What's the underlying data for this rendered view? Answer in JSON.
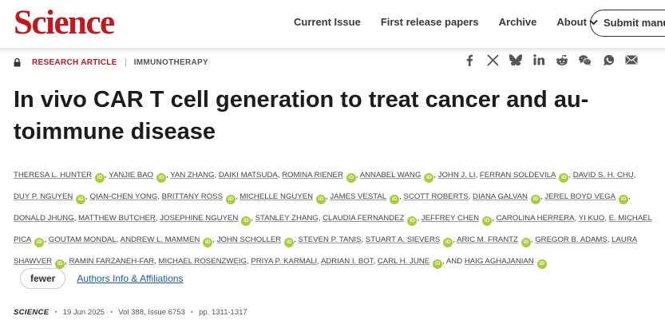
{
  "header": {
    "logo": "Science",
    "nav": [
      "Current Issue",
      "First release papers",
      "Archive",
      "About"
    ],
    "submit_label": "Submit manuscript"
  },
  "meta": {
    "article_type": "RESEARCH ARTICLE",
    "subject": "IMMUNOTHERAPY"
  },
  "share_icons": [
    "facebook-icon",
    "x-icon",
    "bluesky-icon",
    "linkedin-icon",
    "reddit-icon",
    "wechat-icon",
    "whatsapp-icon",
    "email-icon"
  ],
  "title": "In vivo CAR T cell generation to treat cancer and au-toimmune disease",
  "authors": [
    {
      "name": "Theresa L. Hunter",
      "orcid": true
    },
    {
      "name": "Yanjie Bao",
      "orcid": true
    },
    {
      "name": "Yan Zhang",
      "orcid": false
    },
    {
      "name": "Daiki Matsuda",
      "orcid": false
    },
    {
      "name": "Romina Riener",
      "orcid": true
    },
    {
      "name": "Annabel Wang",
      "orcid": true
    },
    {
      "name": "John J. Li",
      "orcid": false
    },
    {
      "name": "Ferran Soldevila",
      "orcid": true
    },
    {
      "name": "David S. H. Chu",
      "orcid": false
    },
    {
      "name": "Duy P. Nguyen",
      "orcid": true
    },
    {
      "name": "Qian-Chen Yong",
      "orcid": false
    },
    {
      "name": "Brittany Ross",
      "orcid": true
    },
    {
      "name": "Michelle Nguyen",
      "orcid": true
    },
    {
      "name": "James Vestal",
      "orcid": true
    },
    {
      "name": "Scott Roberts",
      "orcid": false
    },
    {
      "name": "Diana Galvan",
      "orcid": true
    },
    {
      "name": "Jerel Boyd Vega",
      "orcid": true
    },
    {
      "name": "Donald Jhung",
      "orcid": false
    },
    {
      "name": "Matthew Butcher",
      "orcid": false
    },
    {
      "name": "Josephine Nguyen",
      "orcid": true
    },
    {
      "name": "Stanley Zhang",
      "orcid": false
    },
    {
      "name": "Claudia Fernandez",
      "orcid": true
    },
    {
      "name": "Jeffrey Chen",
      "orcid": true
    },
    {
      "name": "Carolina Herrera",
      "orcid": false
    },
    {
      "name": "Yi Kuo",
      "orcid": false
    },
    {
      "name": "E. Michael Pica",
      "orcid": true
    },
    {
      "name": "Goutam Mondal",
      "orcid": false
    },
    {
      "name": "Andrew L. Mammen",
      "orcid": true
    },
    {
      "name": "John Scholler",
      "orcid": true
    },
    {
      "name": "Steven P. Tanis",
      "orcid": false
    },
    {
      "name": "Stuart A. Sievers",
      "orcid": true
    },
    {
      "name": "Aric M. Frantz",
      "orcid": true
    },
    {
      "name": "Gregor B. Adams",
      "orcid": false
    },
    {
      "name": "Laura Shawver",
      "orcid": true
    },
    {
      "name": "Ramin Farzaneh-Far",
      "orcid": false
    },
    {
      "name": "Michael Rosenzweig",
      "orcid": false
    },
    {
      "name": "Priya P. Karmali",
      "orcid": false
    },
    {
      "name": "Adrian I. Bot",
      "orcid": false
    },
    {
      "name": "Carl H. June",
      "orcid": true
    },
    {
      "name": "Haig Aghajanian",
      "orcid": true
    }
  ],
  "authors_and": "and",
  "orcid_label": "iD",
  "fewer_label": "fewer",
  "info_link": "Authors Info & Affiliations",
  "citation": {
    "journal": "SCIENCE",
    "date": "19 Jun 2025",
    "volume": "Vol 388, Issue 6753",
    "pages": "pp. 1311-1317"
  }
}
